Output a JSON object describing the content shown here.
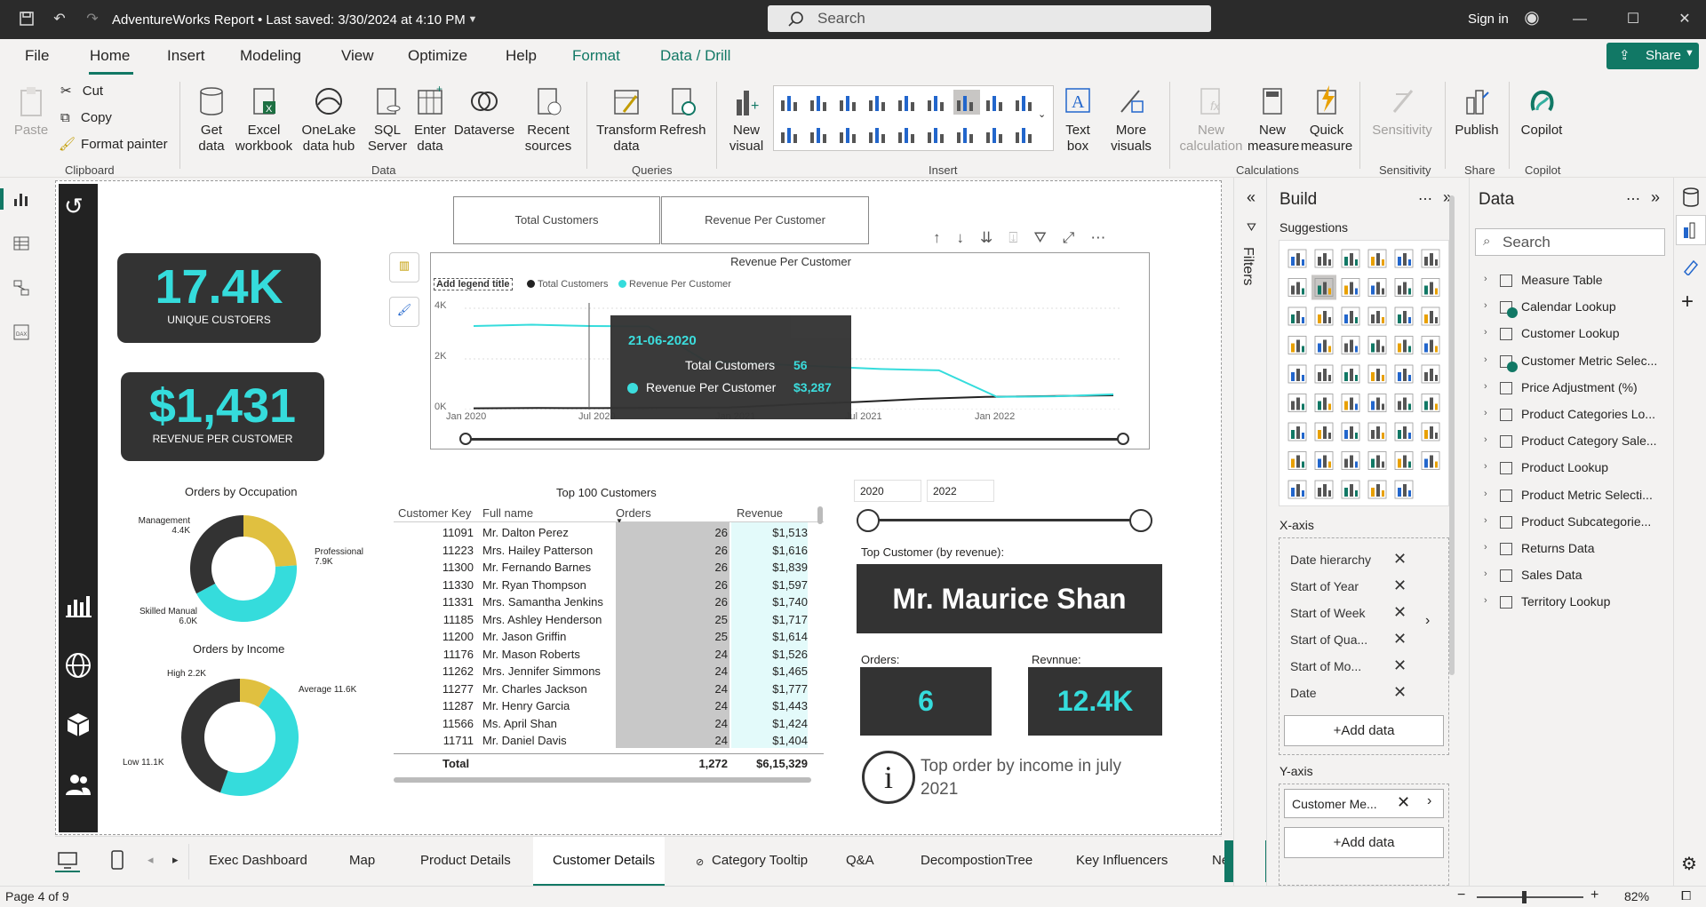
{
  "window": {
    "title": "AdventureWorks Report  •  Last saved: 3/30/2024 at 4:10 PM",
    "search_placeholder": "Search",
    "signin": "Sign in"
  },
  "menu": [
    "File",
    "Home",
    "Insert",
    "Modeling",
    "View",
    "Optimize",
    "Help",
    "Format",
    "Data / Drill"
  ],
  "share": "Share",
  "ribbon": {
    "clipboard": {
      "paste": "Paste",
      "cut": "Cut",
      "copy": "Copy",
      "format_painter": "Format painter",
      "group": "Clipboard"
    },
    "data": {
      "get_data": "Get data",
      "excel": "Excel workbook",
      "onelake": "OneLake data hub",
      "sql": "SQL Server",
      "enter": "Enter data",
      "dataverse": "Dataverse",
      "recent": "Recent sources",
      "group": "Data"
    },
    "queries": {
      "transform": "Transform data",
      "refresh": "Refresh",
      "group": "Queries"
    },
    "insert": {
      "new_visual": "New visual",
      "text_box": "Text box",
      "more_visuals": "More visuals",
      "group": "Insert"
    },
    "calculations": {
      "new_calc": "New calculation",
      "new_measure": "New measure",
      "quick_measure": "Quick measure",
      "group": "Calculations"
    },
    "sensitivity": {
      "label": "Sensitivity",
      "group": "Sensitivity"
    },
    "share": {
      "publish": "Publish",
      "group": "Share"
    },
    "copilot": {
      "label": "Copilot",
      "group": "Copilot"
    }
  },
  "kpis": {
    "customers_value": "17.4K",
    "customers_label": "UNIQUE CUSTOERS",
    "revenue_value": "$1,431",
    "revenue_label": "REVENUE PER CUSTOMER"
  },
  "buttons": {
    "total_customers": "Total Customers",
    "revenue_per_customer": "Revenue Per Customer"
  },
  "line_chart": {
    "title": "Revenue Per Customer",
    "legend_title": "Add legend title",
    "legend": [
      "Total Customers",
      "Revenue Per Customer"
    ],
    "yticks": [
      "4K",
      "2K",
      "0K"
    ],
    "xticks": [
      "Jan 2020",
      "Jul 2020",
      "Jan 2021",
      "Jul 2021",
      "Jan 2022"
    ]
  },
  "tooltip": {
    "date": "21-06-2020",
    "row1_label": "Total Customers",
    "row1_value": "56",
    "row2_label": "Revenue Per Customer",
    "row2_value": "$3,287"
  },
  "donut_occupation": {
    "title": "Orders by Occupation",
    "labels": [
      {
        "name": "Management",
        "value": "4.4K"
      },
      {
        "name": "Professional",
        "value": "7.9K"
      },
      {
        "name": "Skilled Manual",
        "value": "6.0K"
      }
    ]
  },
  "donut_income": {
    "title": "Orders by Income",
    "labels": [
      {
        "name": "High",
        "value": "2.2K"
      },
      {
        "name": "Average",
        "value": "11.6K"
      },
      {
        "name": "Low",
        "value": "11.1K"
      }
    ]
  },
  "chart_data": [
    {
      "type": "line",
      "title": "Revenue Per Customer",
      "x_range": [
        "Jan 2020",
        "Jan 2022"
      ],
      "ylim": [
        0,
        4000
      ],
      "series": [
        {
          "name": "Total Customers",
          "values": [
            50,
            60,
            55,
            70,
            80,
            200,
            300,
            420,
            500,
            530,
            560
          ]
        },
        {
          "name": "Revenue Per Customer",
          "values": [
            3300,
            3350,
            3300,
            3287,
            1900,
            1800,
            1700,
            1600,
            1550,
            500,
            520,
            600
          ]
        }
      ]
    },
    {
      "type": "pie",
      "title": "Orders by Occupation",
      "categories": [
        "Management",
        "Professional",
        "Skilled Manual"
      ],
      "values": [
        4400,
        7900,
        6000
      ]
    },
    {
      "type": "pie",
      "title": "Orders by Income",
      "categories": [
        "High",
        "Average",
        "Low"
      ],
      "values": [
        2200,
        11600,
        11100
      ]
    }
  ],
  "table": {
    "title": "Top 100 Customers",
    "headers": [
      "Customer Key",
      "Full name",
      "Orders",
      "Revenue"
    ],
    "rows": [
      [
        "11091",
        "Mr. Dalton Perez",
        "26",
        "$1,513"
      ],
      [
        "11223",
        "Mrs. Hailey Patterson",
        "26",
        "$1,616"
      ],
      [
        "11300",
        "Mr. Fernando Barnes",
        "26",
        "$1,839"
      ],
      [
        "11330",
        "Mr. Ryan Thompson",
        "26",
        "$1,597"
      ],
      [
        "11331",
        "Mrs. Samantha Jenkins",
        "26",
        "$1,740"
      ],
      [
        "11185",
        "Mrs. Ashley Henderson",
        "25",
        "$1,717"
      ],
      [
        "11200",
        "Mr. Jason Griffin",
        "25",
        "$1,614"
      ],
      [
        "11176",
        "Mr. Mason Roberts",
        "24",
        "$1,526"
      ],
      [
        "11262",
        "Mrs. Jennifer Simmons",
        "24",
        "$1,465"
      ],
      [
        "11277",
        "Mr. Charles Jackson",
        "24",
        "$1,777"
      ],
      [
        "11287",
        "Mr. Henry Garcia",
        "24",
        "$1,443"
      ],
      [
        "11566",
        "Ms. April Shan",
        "24",
        "$1,424"
      ],
      [
        "11711",
        "Mr. Daniel Davis",
        "24",
        "$1,404"
      ]
    ],
    "total_label": "Total",
    "total_orders": "1,272",
    "total_revenue": "$6,15,329"
  },
  "slider": {
    "from": "2020",
    "to": "2022"
  },
  "top_customer": {
    "label": "Top Customer (by revenue):",
    "name": "Mr. Maurice Shan",
    "orders_label": "Orders:",
    "orders_value": "6",
    "revenue_label": "Revnnue:",
    "revenue_value": "12.4K"
  },
  "info_text": "Top order by income in july 2021",
  "pages": [
    "Exec Dashboard",
    "Map",
    "Product Details",
    "Customer Details",
    "Category Tooltip",
    "Q&A",
    "DecompostionTree",
    "Key Influencers",
    "Ne"
  ],
  "status": {
    "page": "Page 4 of 9",
    "zoom": "82%"
  },
  "filters_label": "Filters",
  "build": {
    "title": "Build",
    "suggestions": "Suggestions",
    "xaxis_label": "X-axis",
    "xaxis_fields": [
      "Date hierarchy",
      "Start of Year",
      "Start of Week",
      "Start of Qua...",
      "Start of Mo...",
      "Date"
    ],
    "add_data": "+Add data",
    "yaxis_label": "Y-axis",
    "yaxis_fields": [
      "Customer Me..."
    ]
  },
  "data_pane": {
    "title": "Data",
    "search_placeholder": "Search",
    "tables": [
      "Measure Table",
      "Calendar Lookup",
      "Customer Lookup",
      "Customer Metric Selec...",
      "Price Adjustment (%)",
      "Product Categories Lo...",
      "Product Category Sale...",
      "Product Lookup",
      "Product Metric Selecti...",
      "Product Subcategorie...",
      "Returns Data",
      "Sales Data",
      "Territory Lookup"
    ]
  },
  "colors": {
    "accent": "#117865",
    "teal": "#35dcdc",
    "dark": "#333333",
    "gold": "#e0c040"
  }
}
